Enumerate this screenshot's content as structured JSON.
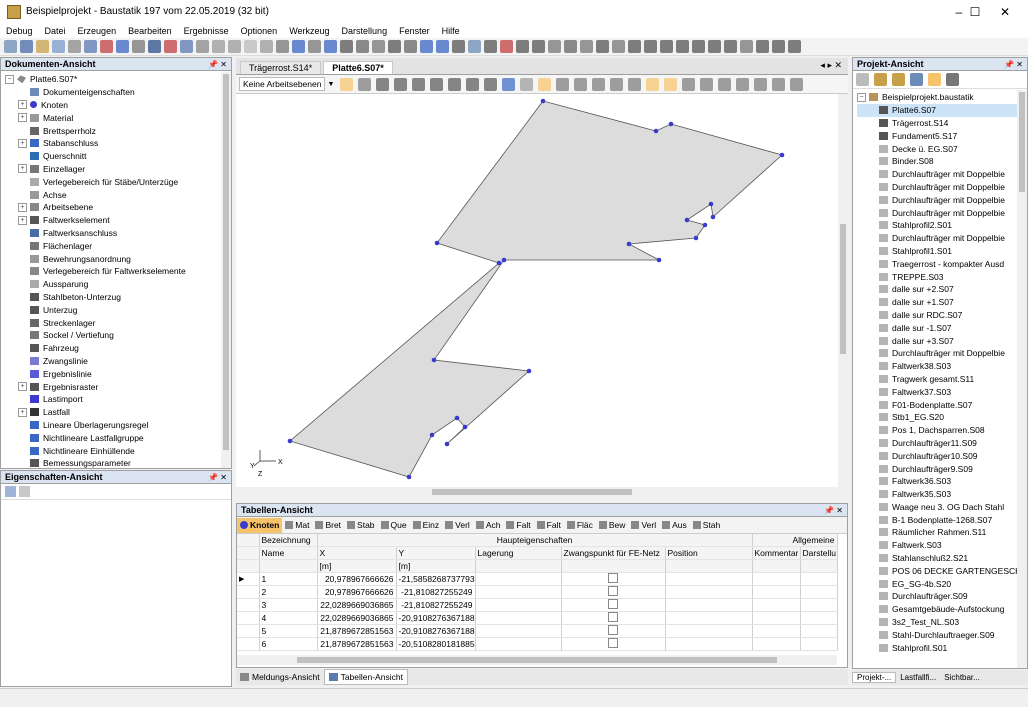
{
  "title": "Beispielprojekt - Baustatik 197 vom 22.05.2019 (32 bit)",
  "window_controls": {
    "minimize": "–",
    "maximize": "☐",
    "close": "✕"
  },
  "menu": [
    "Debug",
    "Datei",
    "Erzeugen",
    "Bearbeiten",
    "Ergebnisse",
    "Optionen",
    "Werkzeug",
    "Darstellung",
    "Fenster",
    "Hilfe"
  ],
  "doc_panel": {
    "title": "Dokumenten-Ansicht",
    "pin": "📌 ✕",
    "root": "Platte6.S07*",
    "items": [
      {
        "label": "Dokumenteigenschaften",
        "exp": false,
        "icon": "doc-icon"
      },
      {
        "label": "Knoten",
        "exp": true,
        "icon": "node-icon"
      },
      {
        "label": "Material",
        "exp": true,
        "icon": "material-icon"
      },
      {
        "label": "Brettsperrholz",
        "exp": false,
        "icon": "clt-icon"
      },
      {
        "label": "Stabanschluss",
        "exp": true,
        "icon": "bar-connection-icon"
      },
      {
        "label": "Querschnitt",
        "exp": false,
        "icon": "section-icon"
      },
      {
        "label": "Einzellager",
        "exp": true,
        "icon": "support-icon"
      },
      {
        "label": "Verlegebereich für Stäbe/Unterzüge",
        "exp": false,
        "icon": "area-icon"
      },
      {
        "label": "Achse",
        "exp": false,
        "icon": "axis-icon"
      },
      {
        "label": "Arbeitsebene",
        "exp": true,
        "icon": "plane-icon"
      },
      {
        "label": "Faltwerkselement",
        "exp": true,
        "icon": "folded-plate-icon"
      },
      {
        "label": "Faltwerksanschluss",
        "exp": false,
        "icon": "plate-connection-icon"
      },
      {
        "label": "Flächenlager",
        "exp": false,
        "icon": "area-support-icon"
      },
      {
        "label": "Bewehrungsanordnung",
        "exp": false,
        "icon": "reinforcement-icon"
      },
      {
        "label": "Verlegebereich für Faltwerkselemente",
        "exp": false,
        "icon": "area-icon"
      },
      {
        "label": "Aussparung",
        "exp": false,
        "icon": "opening-icon"
      },
      {
        "label": "Stahlbeton-Unterzug",
        "exp": false,
        "icon": "beam-icon"
      },
      {
        "label": "Unterzug",
        "exp": false,
        "icon": "beam-icon"
      },
      {
        "label": "Streckenlager",
        "exp": false,
        "icon": "line-support-icon"
      },
      {
        "label": "Sockel / Vertiefung",
        "exp": false,
        "icon": "base-icon"
      },
      {
        "label": "Fahrzeug",
        "exp": false,
        "icon": "vehicle-icon"
      },
      {
        "label": "Zwangslinie",
        "exp": false,
        "icon": "constraint-icon"
      },
      {
        "label": "Ergebnislinie",
        "exp": false,
        "icon": "result-line-icon"
      },
      {
        "label": "Ergebnisraster",
        "exp": true,
        "icon": "grid-icon"
      },
      {
        "label": "Lastimport",
        "exp": false,
        "icon": "load-import-icon"
      },
      {
        "label": "Lastfall",
        "exp": true,
        "icon": "load-case-icon"
      },
      {
        "label": "Lineare Überlagerungsregel",
        "exp": false,
        "icon": "combination-icon"
      },
      {
        "label": "Nichtlineare Lastfallgruppe",
        "exp": false,
        "icon": "group-icon"
      },
      {
        "label": "Nichtlineare Einhüllende",
        "exp": false,
        "icon": "envelope-icon"
      },
      {
        "label": "Bemessungsparameter",
        "exp": false,
        "icon": "design-icon"
      }
    ]
  },
  "prop_panel": {
    "title": "Eigenschaften-Ansicht",
    "pin": "📌 ✕"
  },
  "center_tabs": {
    "tabs": [
      "Trägerrost.S14*",
      "Platte6.S07*"
    ],
    "nav": "◂ ▸ ✕"
  },
  "view_toolbar": {
    "workplane": "Keine Arbeitsebenen"
  },
  "axes": {
    "x": "X",
    "y": "Y",
    "z": "Z"
  },
  "table_panel": {
    "title": "Tabellen-Ansicht",
    "pin": "📌 ✕",
    "tabs": [
      "Knoten",
      "Mat",
      "Bret",
      "Stab",
      "Que",
      "Einz",
      "Verl",
      "Ach",
      "Falt",
      "Falt",
      "Fläc",
      "Bew",
      "Verl",
      "Aus",
      "Stah"
    ],
    "group_header": "Haupteigenschaften",
    "group_header2": "Allgemeine",
    "cols": {
      "bez": "Bezeichnung",
      "name": "Name",
      "x": "X",
      "y": "Y",
      "x_unit": "[m]",
      "y_unit": "[m]",
      "lager": "Lagerung",
      "zwang": "Zwangspunkt für FE-Netz",
      "pos": "Position",
      "komm": "Kommentar",
      "darst": "Darstellu"
    },
    "rows": [
      {
        "name": "1",
        "x": "20,978967666626",
        "y": "-21,5858268737793"
      },
      {
        "name": "2",
        "x": "20,978967666626",
        "y": "-21,810827255249"
      },
      {
        "name": "3",
        "x": "22,0289669036865",
        "y": "-21,810827255249"
      },
      {
        "name": "4",
        "x": "22,0289669036865",
        "y": "-20,9108276367188"
      },
      {
        "name": "5",
        "x": "21,8789672851563",
        "y": "-20,9108276367188"
      },
      {
        "name": "6",
        "x": "21,8789672851563",
        "y": "-20,5108280181885"
      }
    ]
  },
  "bottom_tabs": [
    "Meldungs-Ansicht",
    "Tabellen-Ansicht"
  ],
  "project_panel": {
    "title": "Projekt-Ansicht",
    "pin": "📌 ✕",
    "root": "Beispielprojekt.baustatik",
    "items": [
      "Platte6.S07",
      "Trägerrost.S14",
      "Fundament5.S17",
      "Decke ü. EG.S07",
      "Binder.S08",
      "Durchlaufträger mit Doppelbie",
      "Durchlaufträger mit Doppelbie",
      "Durchlaufträger mit Doppelbie",
      "Durchlaufträger mit Doppelbie",
      "Stahlprofil2.S01",
      "Durchlaufträger mit Doppelbie",
      "Stahlprofil1.S01",
      "Traegerrost - kompakter Ausd",
      "TREPPE.S03",
      "dalle sur +2.S07",
      "dalle sur +1.S07",
      "dalle sur RDC.S07",
      "dalle sur -1.S07",
      "dalle sur +3.S07",
      "Durchlaufträger mit Doppelbie",
      "Faltwerk38.S03",
      "Tragwerk gesamt.S11",
      "Faltwerk37.S03",
      "F01-Bodenplatte.S07",
      "Stb1_EG.S20",
      "Pos 1, Dachsparren.S08",
      "Durchlaufträger11.S09",
      "Durchlaufträger10.S09",
      "Durchlaufträger9.S09",
      "Faltwerk36.S03",
      "Faltwerk35.S03",
      "Waage  neu   3. OG Dach Stahl",
      "B-1 Bodenplatte-1268.S07",
      "Räumlicher Rahmen.S11",
      "Faltwerk.S03",
      "Stahlanschluß2.S21",
      "POS 06 DECKE GARTENGESCH",
      "EG_SG-4b.S20",
      "Durchlaufträger.S09",
      "Gesamtgebäude-Aufstockung",
      "3s2_Test_NL.S03",
      "Stahl-Durchlauftraeger.S09",
      "Stahlprofil.S01"
    ]
  },
  "project_bottom_tabs": [
    "Projekt-...",
    "Lastfallfi...",
    "Sichtbar..."
  ],
  "colors": {
    "accent": "#f6c36a",
    "panel_header": "#dbe4f1",
    "node": "#3a3ad0"
  }
}
